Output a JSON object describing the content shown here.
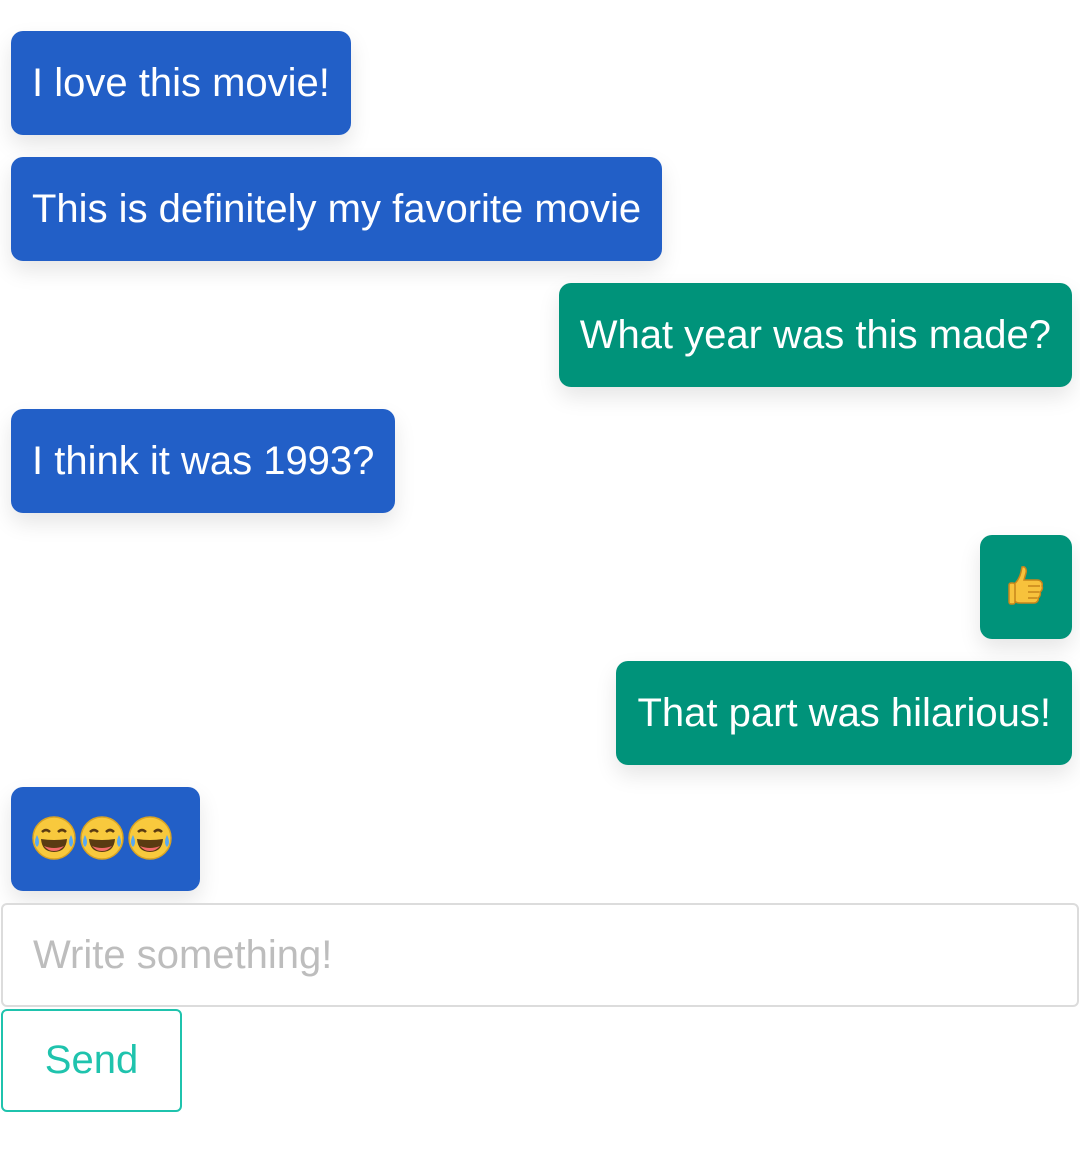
{
  "messages": [
    {
      "sender": "them",
      "text": "I love this movie!"
    },
    {
      "sender": "them",
      "text": "This is definitely my favorite movie"
    },
    {
      "sender": "me",
      "text": "What year was this made?"
    },
    {
      "sender": "them",
      "text": "I think it was 1993?"
    },
    {
      "sender": "me",
      "text": "👍"
    },
    {
      "sender": "me",
      "text": "That part was hilarious!"
    },
    {
      "sender": "them",
      "text": "😂😂😂"
    }
  ],
  "composer": {
    "placeholder": "Write something!",
    "send_label": "Send"
  },
  "colors": {
    "incoming_bubble": "#225fc7",
    "outgoing_bubble": "#00937a",
    "send_accent": "#1fc3ad"
  }
}
